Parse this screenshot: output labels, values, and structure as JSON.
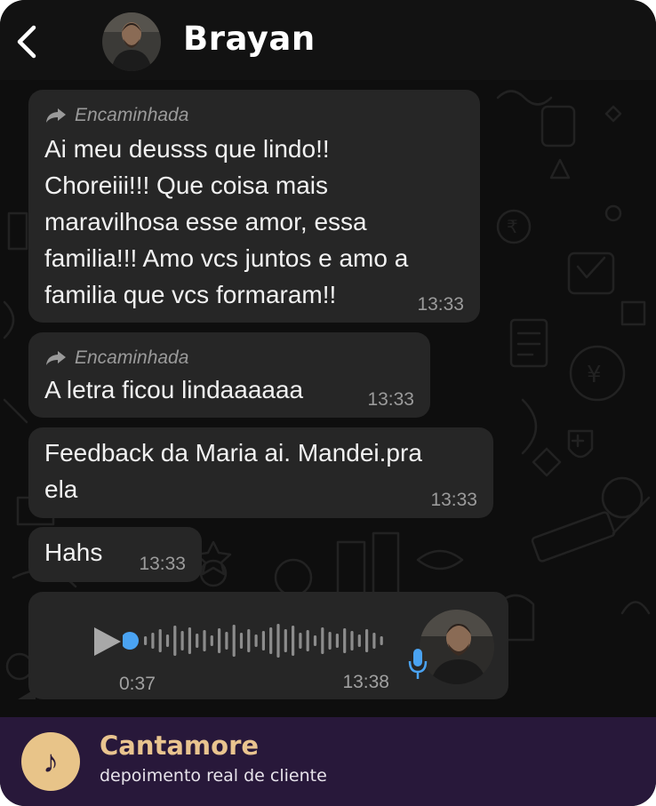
{
  "header": {
    "contact_name": "Brayan"
  },
  "messages": [
    {
      "forwarded_label": "Encaminhada",
      "text": "Ai meu deusss que lindo!!\nChoreiii!!! Que coisa mais\nmaravilhosa esse amor, essa\nfamilia!!! Amo vcs juntos e amo a\nfamilia que vcs formaram!!",
      "time": "13:33"
    },
    {
      "forwarded_label": "Encaminhada",
      "text": "A letra ficou lindaaaaaa",
      "time": "13:33"
    },
    {
      "text": "Feedback da Maria ai. Mandei.pra\nela",
      "time": "13:33"
    },
    {
      "text": "Hahs",
      "time": "13:33"
    }
  ],
  "audio": {
    "duration": "0:37",
    "time": "13:38",
    "progress": 0
  },
  "footer": {
    "brand_name": "Cantamore",
    "tagline": "depoimento real de cliente",
    "logo_glyph": "♪"
  },
  "colors": {
    "bubble": "#262626",
    "accent_blue": "#4aa3f2",
    "footer_bg": "#28183a",
    "brand_gold": "#e9c48f"
  },
  "icons": [
    "back-chevron-icon",
    "forward-arrow-icon",
    "play-icon",
    "microphone-icon",
    "music-note-icon"
  ]
}
